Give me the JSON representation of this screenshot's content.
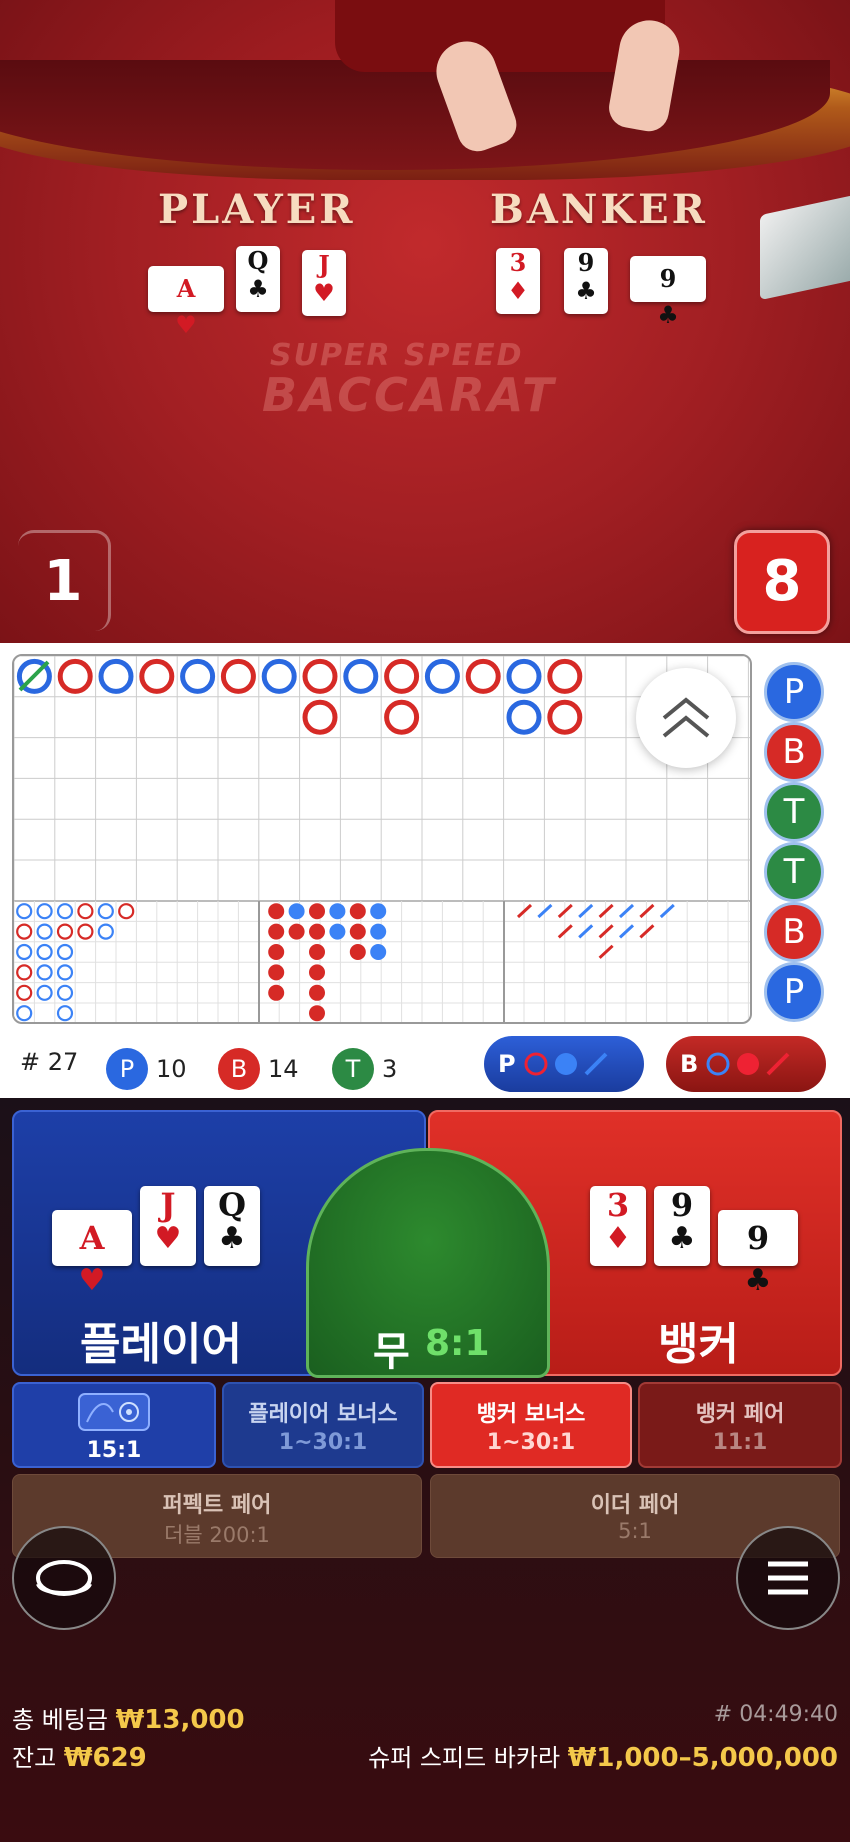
{
  "video": {
    "player_label": "PLAYER",
    "banker_label": "BANKER",
    "logo_top": "SUPER SPEED",
    "logo_bottom": "BACCARAT",
    "player_score": "1",
    "banker_score": "8",
    "player_cards": [
      {
        "rank": "A",
        "suit": "♥",
        "color": "red"
      },
      {
        "rank": "Q",
        "suit": "♣",
        "color": "black"
      },
      {
        "rank": "J",
        "suit": "♥",
        "color": "red"
      }
    ],
    "banker_cards": [
      {
        "rank": "3",
        "suit": "♦",
        "color": "red"
      },
      {
        "rank": "9",
        "suit": "♣",
        "color": "black"
      },
      {
        "rank": "9",
        "suit": "♣",
        "color": "black"
      }
    ]
  },
  "roads": {
    "big_road_columns": [
      [
        "p"
      ],
      [
        "b"
      ],
      [
        "p"
      ],
      [
        "b"
      ],
      [
        "p"
      ],
      [
        "b"
      ],
      [
        "p"
      ],
      [
        "b",
        "b"
      ],
      [
        "p"
      ],
      [
        "b",
        "b"
      ],
      [
        "p"
      ],
      [
        "b"
      ],
      [
        "p",
        "p"
      ],
      [
        "b",
        "b"
      ]
    ],
    "predictions": [
      "P",
      "B",
      "T",
      "T",
      "B",
      "P"
    ]
  },
  "stats": {
    "round_label": "# 27",
    "player_letter": "P",
    "player_count": "10",
    "banker_letter": "B",
    "banker_count": "14",
    "tie_letter": "T",
    "tie_count": "3",
    "ask_player": "P",
    "ask_banker": "B"
  },
  "bets": {
    "player_label": "플레이어",
    "tie_label": "무",
    "tie_odds": "8:1",
    "banker_label": "뱅커",
    "dragon_odds": "15:1",
    "player_bonus_label": "플레이어 보너스",
    "player_bonus_odds": "1~30:1",
    "banker_bonus_label": "뱅커 보너스",
    "banker_bonus_odds": "1~30:1",
    "banker_pair_label": "뱅커 페어",
    "banker_pair_odds": "11:1",
    "perfect_pair_label": "퍼펙트 페어",
    "perfect_pair_odds": "더블 200:1",
    "either_pair_label": "이더 페어",
    "either_pair_odds": "5:1",
    "player_cards": [
      {
        "rank": "A",
        "suit": "♥",
        "color": "red"
      },
      {
        "rank": "J",
        "suit": "♥",
        "color": "red"
      },
      {
        "rank": "Q",
        "suit": "♣",
        "color": "black"
      }
    ],
    "banker_cards": [
      {
        "rank": "3",
        "suit": "♦",
        "color": "red"
      },
      {
        "rank": "9",
        "suit": "♣",
        "color": "black"
      },
      {
        "rank": "9",
        "suit": "♣",
        "color": "black"
      }
    ]
  },
  "footer": {
    "total_bet_label": "총 베팅금",
    "total_bet_value": "₩13,000",
    "balance_label": "잔고",
    "balance_value": "₩629",
    "game_id": "# 04:49:40",
    "game_name": "슈퍼 스피드 바카라",
    "limits": "₩1,000–5,000,000"
  },
  "colors": {
    "player_blue": "#1f4fc9",
    "banker_red": "#d8221f",
    "tie_green": "#2e8b3a",
    "gold": "#f4c84a"
  }
}
